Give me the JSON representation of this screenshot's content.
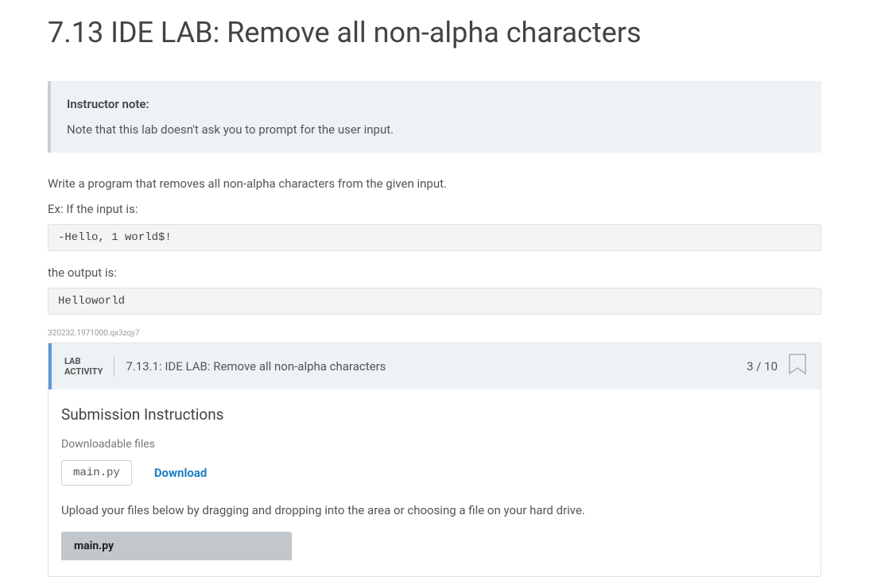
{
  "page": {
    "title": "7.13 IDE LAB: Remove all non-alpha characters"
  },
  "note": {
    "title": "Instructor note:",
    "body": "Note that this lab doesn't ask you to prompt for the user input."
  },
  "problem": {
    "description": "Write a program that removes all non-alpha characters from the given input.",
    "example_label": "Ex: If the input is:",
    "example_input": "-Hello, 1 world$!",
    "output_label": "the output is:",
    "example_output": "Helloworld"
  },
  "tiny_id": "320232.1971000.qx3zqy7",
  "lab": {
    "activity_tag": "LAB\nACTIVITY",
    "title": "7.13.1: IDE LAB: Remove all non-alpha characters",
    "score": "3 / 10",
    "submission_heading": "Submission Instructions",
    "downloadable_label": "Downloadable files",
    "file_name": "main.py",
    "download_label": "Download",
    "upload_instructions": "Upload your files below by dragging and dropping into the area or choosing a file on your hard drive.",
    "upload_tab": "main.py"
  }
}
